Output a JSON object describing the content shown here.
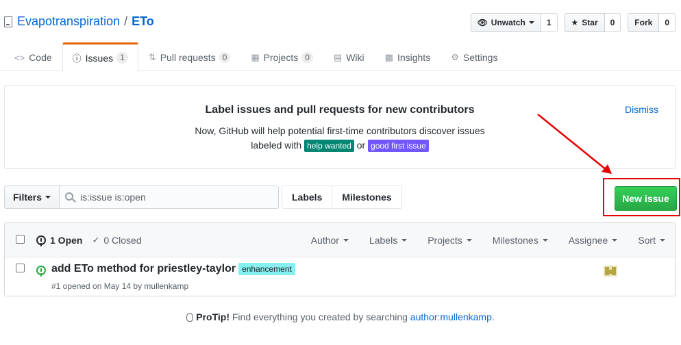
{
  "repo": {
    "owner": "Evapotranspiration",
    "separator": "/",
    "name": "ETo"
  },
  "actions": {
    "watch": {
      "label": "Unwatch",
      "count": "1"
    },
    "star": {
      "label": "Star",
      "count": "0"
    },
    "fork": {
      "label": "Fork",
      "count": "0"
    }
  },
  "nav": {
    "code": {
      "label": "Code",
      "icon": "code-icon"
    },
    "issues": {
      "label": "Issues",
      "count": "1",
      "icon": "issue-opened-icon"
    },
    "pulls": {
      "label": "Pull requests",
      "count": "0",
      "icon": "git-pull-request-icon"
    },
    "projects": {
      "label": "Projects",
      "count": "0",
      "icon": "project-icon"
    },
    "wiki": {
      "label": "Wiki",
      "icon": "book-icon"
    },
    "insights": {
      "label": "Insights",
      "icon": "graph-icon"
    },
    "settings": {
      "label": "Settings",
      "icon": "gear-icon"
    }
  },
  "banner": {
    "title": "Label issues and pull requests for new contributors",
    "line1": "Now, GitHub will help potential first-time contributors discover issues",
    "line2_prefix": "labeled with",
    "label_help_wanted": "help wanted",
    "label_help_wanted_color": "#008672",
    "or_text": "or",
    "label_good_first": "good first issue",
    "label_good_first_color": "#7057ff",
    "dismiss": "Dismiss"
  },
  "subnav": {
    "filters_label": "Filters",
    "search_value": "is:issue is:open",
    "labels_link": "Labels",
    "milestones_link": "Milestones",
    "new_issue": "New issue"
  },
  "issues_header": {
    "open_count": "1 Open",
    "closed_count": "0 Closed",
    "filters": [
      "Author",
      "Labels",
      "Projects",
      "Milestones",
      "Assignee",
      "Sort"
    ]
  },
  "issues": [
    {
      "title": "add ETo method for priestley-taylor",
      "label": "enhancement",
      "label_color": "#84f0ef",
      "meta": "#1 opened on May 14 by mullenkamp"
    }
  ],
  "protip": {
    "bold": "ProTip!",
    "text": "Find everything you created by searching",
    "link": "author:mullenkamp",
    "end": "."
  },
  "annotation": {
    "highlight_color": "#e60000"
  }
}
